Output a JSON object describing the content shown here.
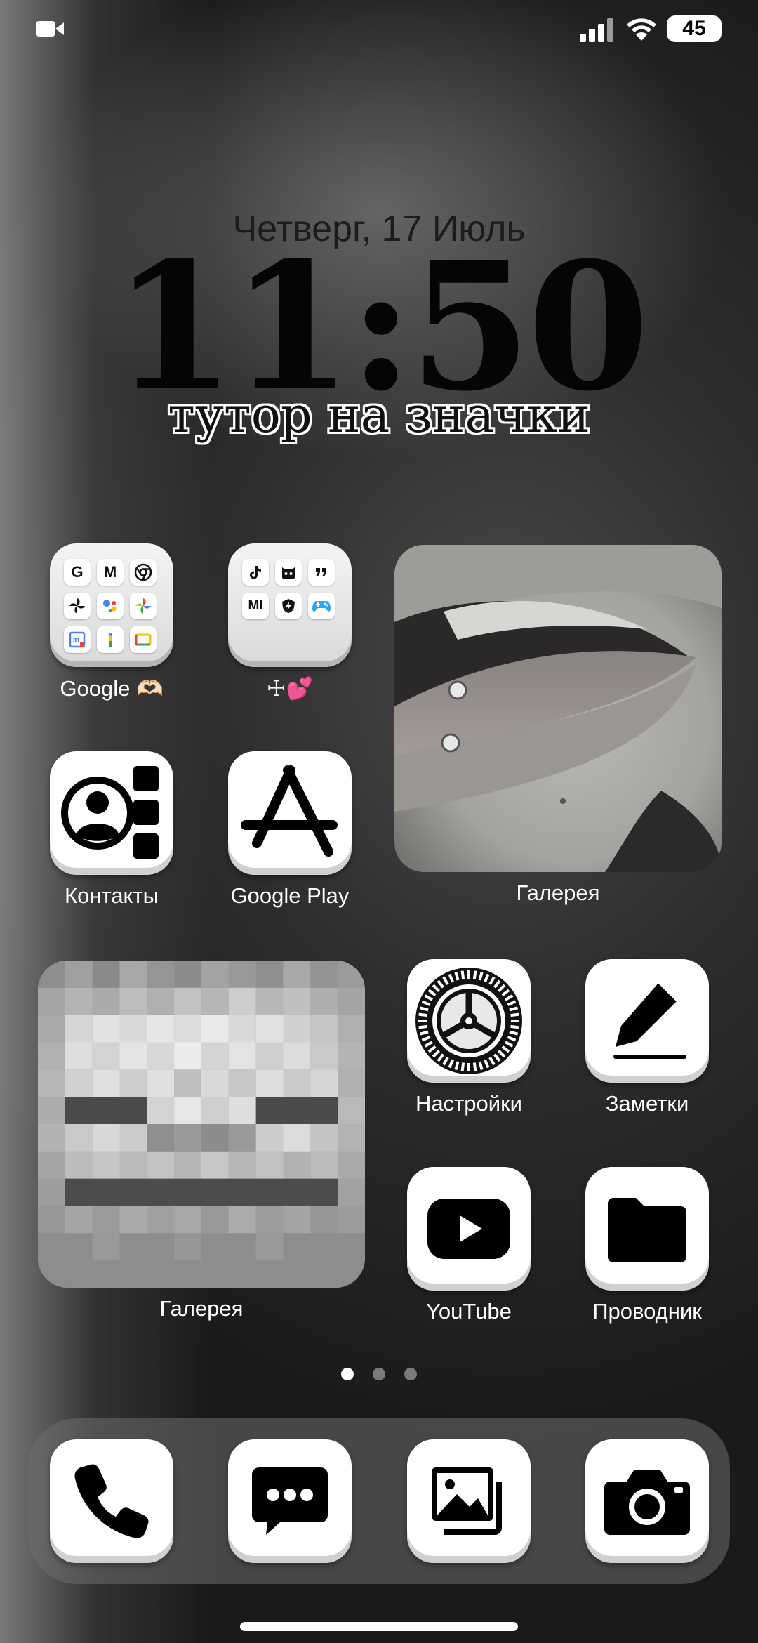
{
  "status_bar": {
    "battery": "45",
    "icons": [
      "video-camera-icon",
      "signal-icon",
      "wifi-icon",
      "battery-icon"
    ]
  },
  "lockclock": {
    "date": "Четверг, 17 Июль",
    "time": "11:50",
    "caption": "тутор на значки"
  },
  "apps": {
    "google_folder": {
      "label": "Google 🫶🏻",
      "contents": [
        "G",
        "M",
        "chrome-icon",
        "pinwheel-icon",
        "assistant-icon",
        "photos-icon",
        "31",
        "1",
        "slides-icon"
      ]
    },
    "second_folder": {
      "label": "☩💕",
      "contents": [
        "tiktok-icon",
        "mi-robot-icon",
        "quote-icon",
        "MI",
        "shield-bolt-icon",
        "gamepad-icon"
      ]
    },
    "contacts": {
      "label": "Контакты"
    },
    "google_play": {
      "label": "Google Play"
    },
    "gallery_widget_1": {
      "label": "Галерея"
    },
    "gallery_widget_2": {
      "label": "Галерея"
    },
    "settings": {
      "label": "Настройки"
    },
    "notes": {
      "label": "Заметки"
    },
    "youtube": {
      "label": "YouTube"
    },
    "explorer": {
      "label": "Проводник"
    }
  },
  "page_indicator": {
    "pages": 3,
    "active": 1
  },
  "dock": [
    "phone-icon",
    "messages-icon",
    "gallery-icon",
    "camera-icon"
  ]
}
